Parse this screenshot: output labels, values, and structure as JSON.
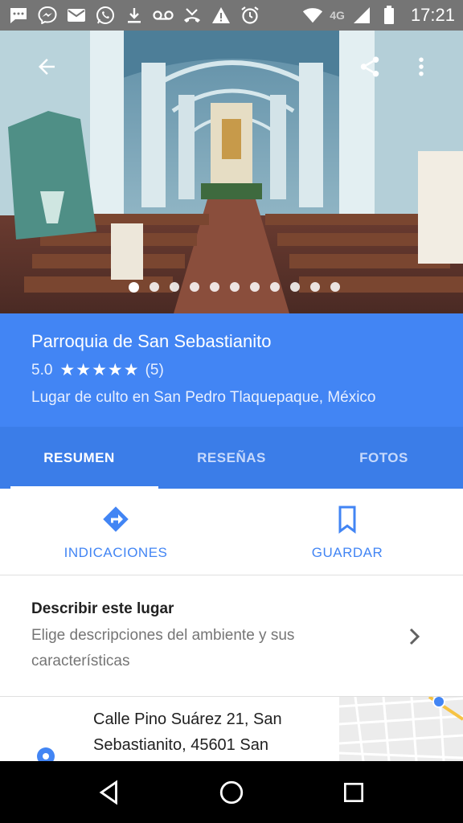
{
  "status_bar": {
    "time": "17:21",
    "network": "4G",
    "icons": [
      "messages-icon",
      "messenger-icon",
      "email-icon",
      "whatsapp-icon",
      "download-icon",
      "voicemail-icon",
      "missed-call-icon",
      "warning-icon",
      "alarm-icon",
      "wifi-icon",
      "signal-icon",
      "battery-icon"
    ]
  },
  "hero": {
    "photo_count": 11,
    "active_index": 0,
    "icons": {
      "back": "arrow-back-icon",
      "share": "share-icon",
      "more": "more-vert-icon"
    }
  },
  "place": {
    "name": "Parroquia de San Sebastianito",
    "rating": "5.0",
    "stars": "★★★★★",
    "reviews": "(5)",
    "category": "Lugar de culto en San Pedro Tlaquepaque, México"
  },
  "tabs": [
    {
      "label": "RESUMEN",
      "active": true
    },
    {
      "label": "RESEÑAS",
      "active": false
    },
    {
      "label": "FOTOS",
      "active": false
    }
  ],
  "actions": {
    "directions": "INDICACIONES",
    "save": "GUARDAR"
  },
  "describe": {
    "title": "Describir este lugar",
    "text": "Elige descripciones del ambiente y sus características"
  },
  "address": {
    "text": "Calle Pino Suárez 21, San Sebastianito, 45601 San"
  },
  "colors": {
    "primary": "#4285f4",
    "tab_bar": "#3b7de8",
    "status_bar": "#757575"
  }
}
